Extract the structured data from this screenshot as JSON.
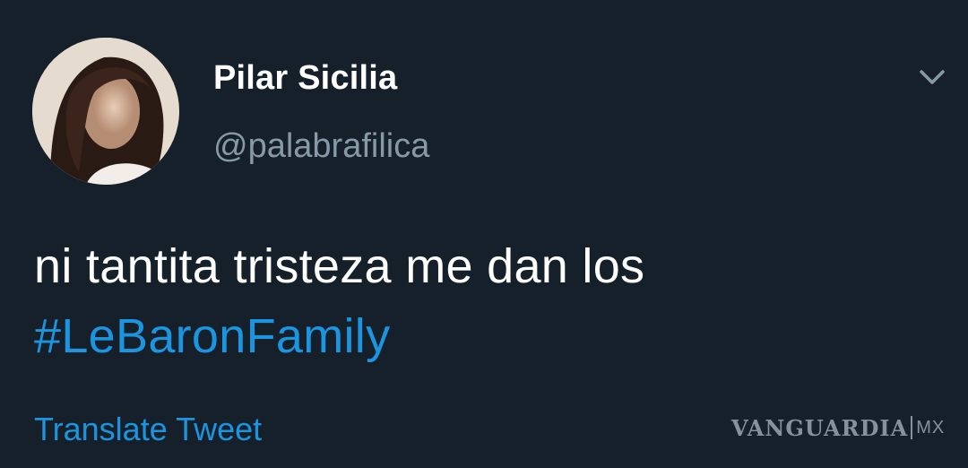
{
  "tweet": {
    "author_name": "Pilar Sicilia",
    "author_handle": "@palabrafilica",
    "text_plain": "ni tantita tristeza me dan los",
    "hashtag": "#LeBaronFamily",
    "translate_label": "Translate Tweet",
    "menu_icon": "chevron-down-icon",
    "avatar_icon": "profile-photo"
  },
  "watermark": {
    "brand": "VANGUARDIA",
    "region": "MX"
  },
  "colors": {
    "background": "#15202b",
    "primary_text": "#ffffff",
    "secondary_text": "#8899a6",
    "link": "#1b95e0"
  }
}
